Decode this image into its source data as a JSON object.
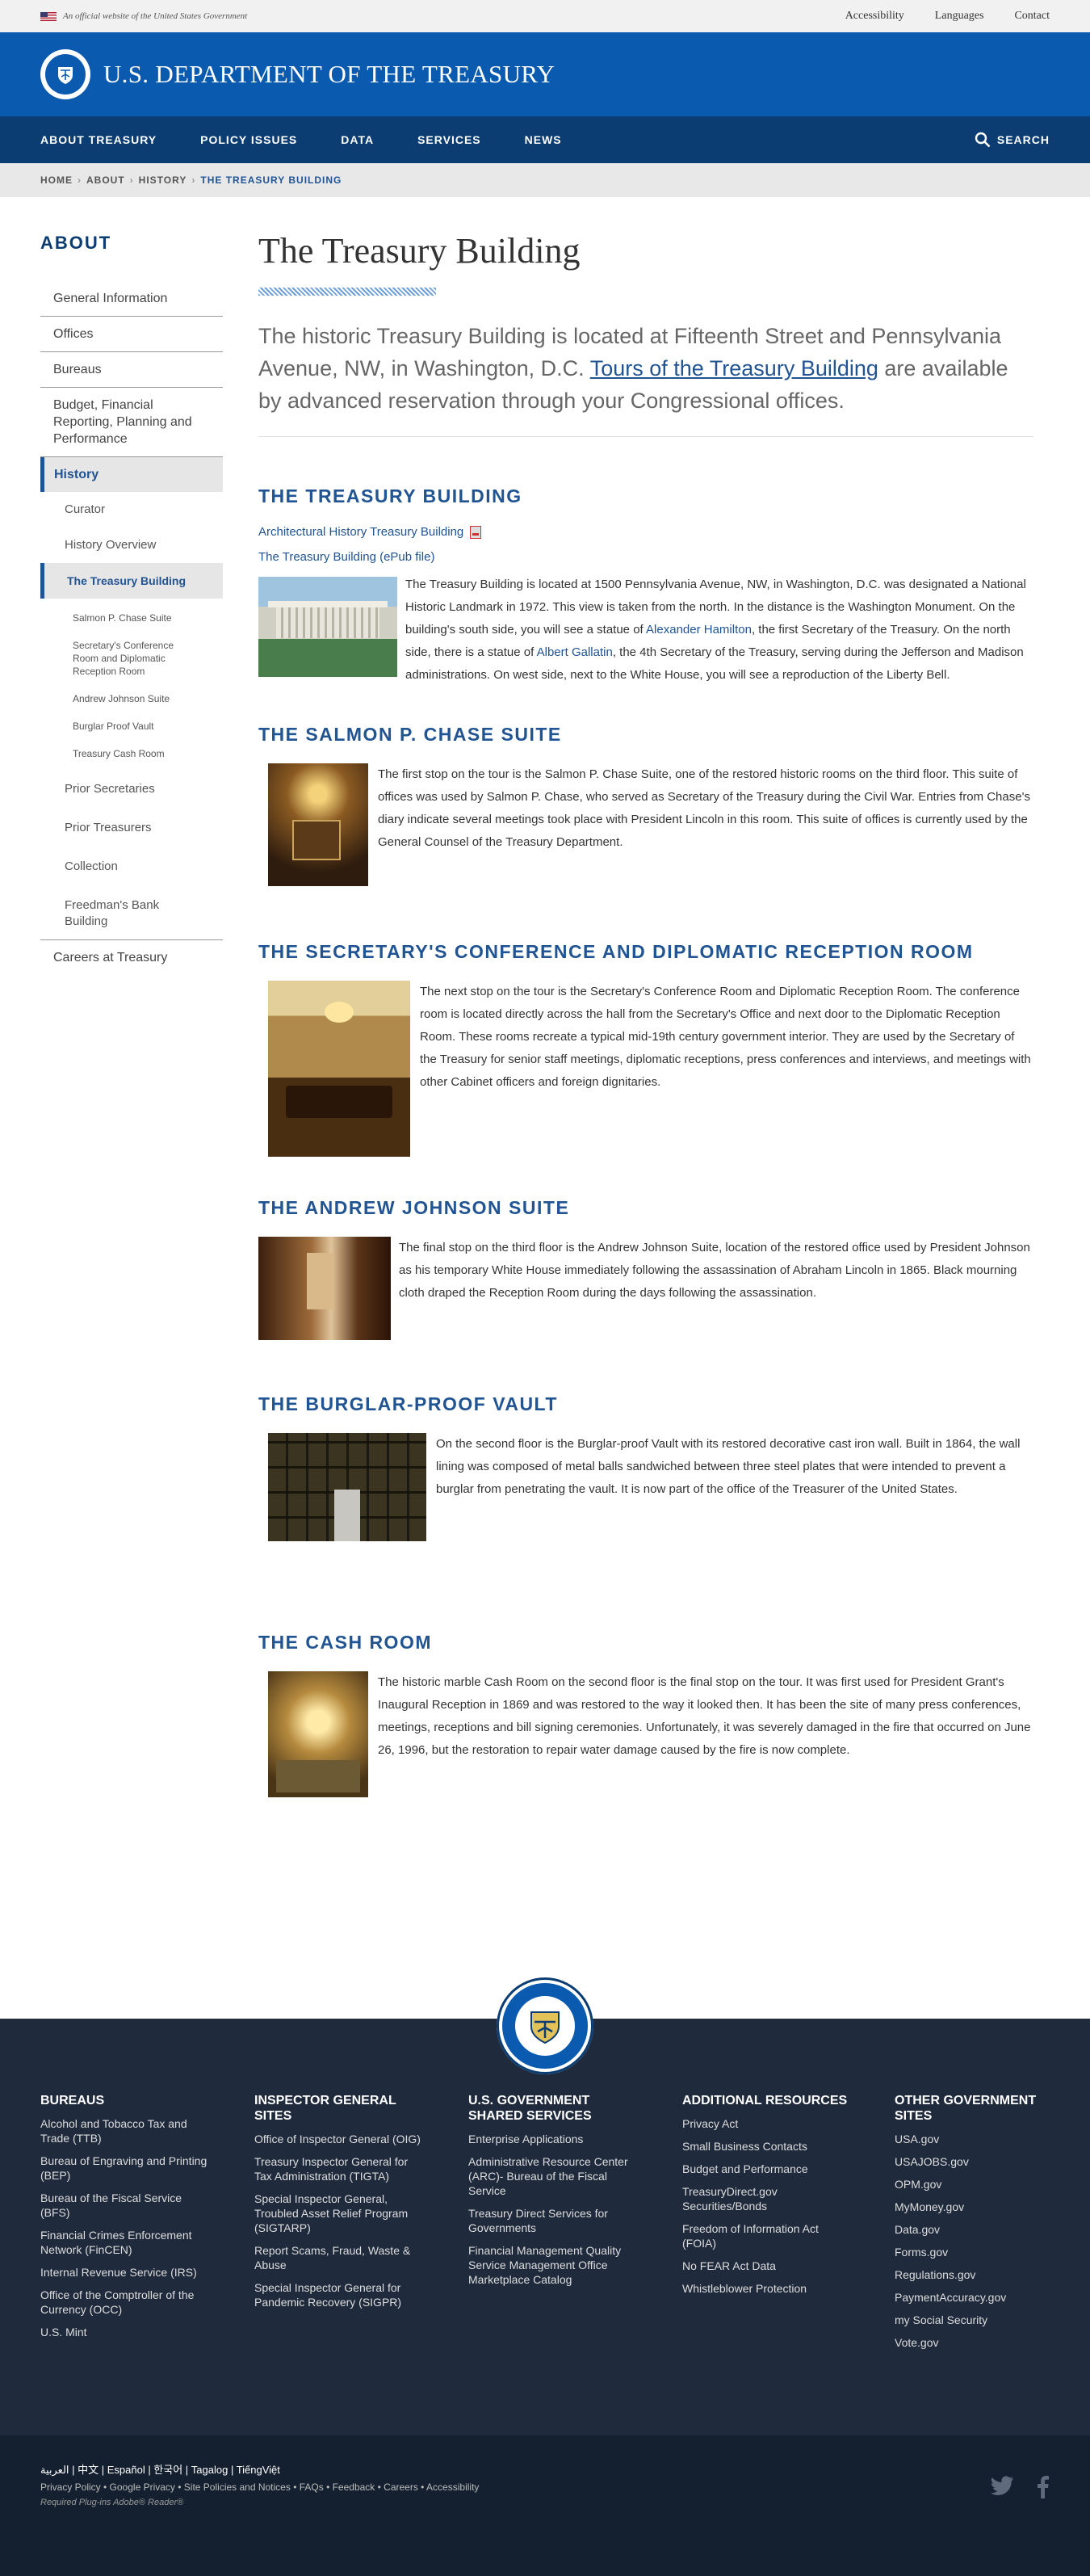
{
  "topbar": {
    "official": "An official website of the United States Government",
    "links": [
      "Accessibility",
      "Languages",
      "Contact"
    ]
  },
  "header": {
    "title": "U.S. DEPARTMENT OF THE TREASURY"
  },
  "nav": {
    "items": [
      "ABOUT TREASURY",
      "POLICY ISSUES",
      "DATA",
      "SERVICES",
      "NEWS"
    ],
    "search": "SEARCH"
  },
  "breadcrumb": [
    "HOME",
    "ABOUT",
    "HISTORY",
    "THE TREASURY BUILDING"
  ],
  "sidebar": {
    "heading": "ABOUT",
    "items": [
      "General Information",
      "Offices",
      "Bureaus",
      "Budget, Financial Reporting, Planning and Performance",
      "History"
    ],
    "history_sub": [
      "Curator",
      "History Overview",
      "The Treasury Building"
    ],
    "building_sub": [
      "Salmon P. Chase Suite",
      "Secretary's Conference Room and Diplomatic Reception Room",
      "Andrew Johnson Suite",
      "Burglar Proof Vault",
      "Treasury Cash Room"
    ],
    "history_sub2": [
      "Prior Secretaries",
      "Prior Treasurers",
      "Collection",
      "Freedman's Bank Building"
    ],
    "last": "Careers at Treasury"
  },
  "page": {
    "title": "The Treasury Building",
    "intro_a": "The historic Treasury Building is located at Fifteenth Street and Pennsylvania Avenue, NW, in Washington, D.C. ",
    "intro_link": "Tours of the Treasury Building",
    "intro_b": " are available by advanced reservation through your Congressional offices."
  },
  "s1": {
    "title": "THE TREASURY BUILDING",
    "link1": "Architectural History Treasury Building",
    "link2": "The Treasury Building (ePub file)",
    "t1": "The Treasury Building is located at 1500 Pennsylvania Avenue, NW, in Washington, D.C. was designated a National Historic Landmark in 1972. This view is taken from the north. In the distance is the Washington Monument. On the building's south side, you will see a statue of ",
    "l1": "Alexander Hamilton",
    "t2": ", the first Secretary of the Treasury. On the north side, there is a statue of ",
    "l2": "Albert Gallatin",
    "t3": ", the 4th Secretary of the Treasury, serving during the Jefferson and Madison administrations. On west side, next to the White House, you will see a reproduction of the Liberty Bell."
  },
  "s2": {
    "title": "THE SALMON P. CHASE SUITE",
    "text": "The first stop on the tour is the Salmon P. Chase Suite, one of the restored historic rooms on the third floor. This suite of offices was used by Salmon P. Chase, who served as Secretary of the Treasury during the Civil War. Entries from Chase's diary indicate several meetings took place with President Lincoln in this room. This suite of offices is currently used by the General Counsel of the Treasury Department."
  },
  "s3": {
    "title": "THE SECRETARY'S CONFERENCE AND DIPLOMATIC RECEPTION ROOM",
    "text": "The next stop on the tour is the Secretary's Conference Room and Diplomatic Reception Room. The conference room is located directly across the hall from the Secretary's Office and next door to the Diplomatic Reception Room. These rooms recreate a typical mid-19th century government interior. They are used by the Secretary of the Treasury for senior staff meetings, diplomatic receptions, press conferences and interviews, and meetings with other Cabinet officers and foreign dignitaries."
  },
  "s4": {
    "title": "THE ANDREW JOHNSON SUITE",
    "text": "The final stop on the third floor is the Andrew Johnson Suite, location of the restored office used by President Johnson as his temporary White House immediately following the assassination of Abraham Lincoln in 1865. Black mourning cloth draped the Reception Room during the days following the assassination."
  },
  "s5": {
    "title": "THE BURGLAR-PROOF VAULT",
    "text": "On the second floor is the Burglar-proof Vault with its restored decorative cast iron wall. Built in 1864, the wall lining was composed of metal balls sandwiched between three steel plates that were intended to prevent a burglar from penetrating the vault. It is now part of the office of the Treasurer of the United States."
  },
  "s6": {
    "title": "THE CASH ROOM",
    "text": "The historic marble Cash Room on the second floor is the final stop on the tour. It was first used for President Grant's Inaugural Reception in 1869 and was restored to the way it looked then. It has been the site of many press conferences, meetings, receptions and bill signing ceremonies. Unfortunately, it was severely damaged in the fire that occurred on June 26, 1996, but the restoration to repair water damage caused by the fire is now complete."
  },
  "footer": {
    "cols": [
      {
        "title": "BUREAUS",
        "items": [
          "Alcohol and Tobacco Tax and Trade (TTB)",
          "Bureau of Engraving and Printing (BEP)",
          "Bureau of the Fiscal Service (BFS)",
          "Financial Crimes Enforcement Network (FinCEN)",
          "Internal Revenue Service (IRS)",
          "Office of the Comptroller of the Currency (OCC)",
          "U.S. Mint"
        ]
      },
      {
        "title": "INSPECTOR GENERAL SITES",
        "items": [
          "Office of Inspector General (OIG)",
          "Treasury Inspector General for Tax Administration (TIGTA)",
          "Special Inspector General, Troubled Asset Relief Program (SIGTARP)",
          "Report Scams, Fraud, Waste & Abuse",
          "Special Inspector General for Pandemic Recovery (SIGPR)"
        ]
      },
      {
        "title": "U.S. GOVERNMENT SHARED SERVICES",
        "items": [
          "Enterprise Applications",
          "Administrative Resource Center (ARC)- Bureau of the Fiscal Service",
          "Treasury Direct Services for Governments",
          "Financial Management Quality Service Management Office Marketplace Catalog"
        ]
      },
      {
        "title": "ADDITIONAL RESOURCES",
        "items": [
          "Privacy Act",
          "Small Business Contacts",
          "Budget and Performance",
          "TreasuryDirect.gov Securities/Bonds",
          "Freedom of Information Act (FOIA)",
          "No FEAR Act Data",
          "Whistleblower Protection"
        ]
      },
      {
        "title": "OTHER GOVERNMENT SITES",
        "items": [
          "USA.gov",
          "USAJOBS.gov",
          "OPM.gov",
          "MyMoney.gov",
          "Data.gov",
          "Forms.gov",
          "Regulations.gov",
          "PaymentAccuracy.gov",
          "my Social Security",
          "Vote.gov"
        ]
      }
    ],
    "langs": "العربية | 中文 | Español | 한국어 | Tagalog | TiếngViệt",
    "policy": "Privacy Policy • Google Privacy • Site Policies and Notices • FAQs • Feedback • Careers • Accessibility",
    "plugins": "Required Plug-ins Adobe® Reader®"
  }
}
